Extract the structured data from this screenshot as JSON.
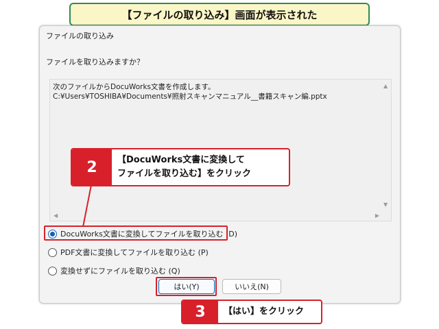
{
  "banner": {
    "text": "【ファイルの取り込み】画面が表示された"
  },
  "dialog": {
    "title": "ファイルの取り込み",
    "prompt": "ファイルを取り込みますか？",
    "message_line1": "次のファイルからDocuWorks文書を作成します。",
    "message_line2": "C:¥Users¥TOSHIBA¥Documents¥照射スキャンマニュアル__書籍スキャン編.pptx",
    "options": [
      {
        "label": "DocuWorks文書に変換してファイルを取り込む (D)",
        "checked": true
      },
      {
        "label": "PDF文書に変換してファイルを取り込む (P)",
        "checked": false
      },
      {
        "label": "変換せずにファイルを取り込む (Q)",
        "checked": false
      }
    ],
    "yes_button": "はい(Y)",
    "no_button": "いいえ(N)"
  },
  "callout2": {
    "number": "2",
    "line1": "【DocuWorks文書に変換して",
    "line2": "ファイルを取り込む】をクリック"
  },
  "callout3": {
    "number": "3",
    "text": "【はい】をクリック"
  },
  "colors": {
    "callout_red": "#d8202a",
    "banner_bg": "#fbf6c7",
    "banner_border": "#2e8b57",
    "accent_blue": "#1561b0"
  },
  "icons": {
    "scroll_up": "chevron-up-icon",
    "scroll_down": "chevron-down-icon",
    "scroll_left": "chevron-left-icon",
    "scroll_right": "chevron-right-icon"
  }
}
